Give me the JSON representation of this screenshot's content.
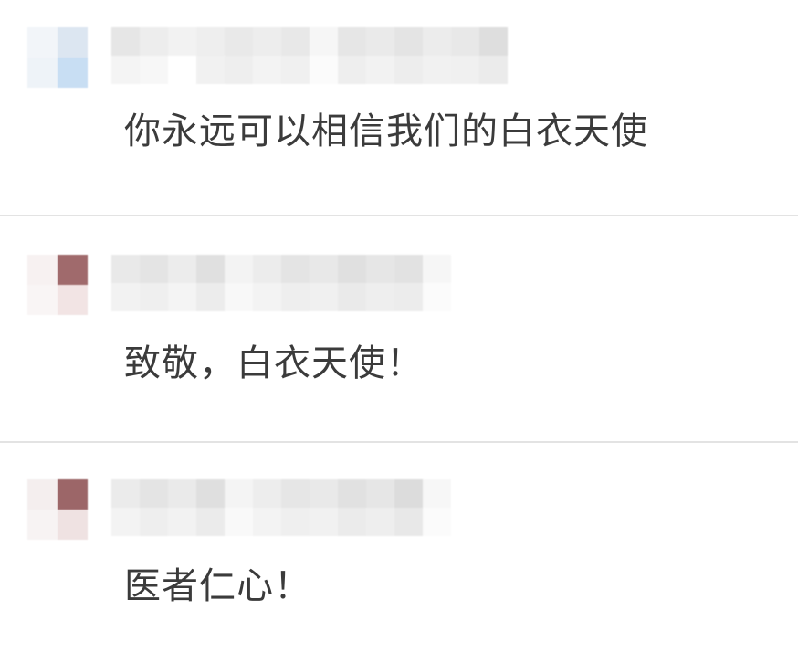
{
  "comments": [
    {
      "text": "你永远可以相信我们的白衣天使",
      "avatar_colors": [
        "#f2f5f9",
        "#dce6f1",
        "#eef3f8",
        "#c8def3"
      ],
      "name_colors": [
        [
          "#e6e6e6",
          "#f4f4f4"
        ],
        [
          "#ededed",
          "#f7f7f7"
        ],
        [
          "#f2f2f2",
          "#ffffff"
        ],
        [
          "#eeeeee",
          "#f1f1f1"
        ],
        [
          "#e9e9e9",
          "#eeeeee"
        ],
        [
          "#ededed",
          "#f3f3f3"
        ],
        [
          "#e8e8e8",
          "#f0f0f0"
        ],
        [
          "#f6f6f6",
          "#fbfbfb"
        ],
        [
          "#e6e6e6",
          "#eeeeee"
        ],
        [
          "#eaeaea",
          "#f2f2f2"
        ],
        [
          "#e4e4e4",
          "#ededed"
        ],
        [
          "#ececec",
          "#f1f1f1"
        ],
        [
          "#e8e8e8",
          "#f0f0f0"
        ],
        [
          "#dedede",
          "#ebebeb"
        ]
      ]
    },
    {
      "text": "致敬，白衣天使！",
      "avatar_colors": [
        "#f7f1f1",
        "#a06a6c",
        "#f9f5f5",
        "#f2e4e4"
      ],
      "name_colors": [
        [
          "#e9e9e9",
          "#f2f2f2"
        ],
        [
          "#e4e4e4",
          "#efefef"
        ],
        [
          "#ececec",
          "#f4f4f4"
        ],
        [
          "#e0e0e0",
          "#ececec"
        ],
        [
          "#f3f3f3",
          "#f8f8f8"
        ],
        [
          "#ececec",
          "#f3f3f3"
        ],
        [
          "#e4e4e4",
          "#eeeeee"
        ],
        [
          "#e8e8e8",
          "#f0f0f0"
        ],
        [
          "#e0e0e0",
          "#eaeaea"
        ],
        [
          "#e6e6e6",
          "#eeeeee"
        ],
        [
          "#e2e2e2",
          "#ececec"
        ],
        [
          "#f6f6f6",
          "#fbfbfb"
        ]
      ]
    },
    {
      "text": "医者仁心！",
      "avatar_colors": [
        "#f4eeee",
        "#9c6668",
        "#f7f3f3",
        "#efe2e2"
      ],
      "name_colors": [
        [
          "#ebebeb",
          "#f3f3f3"
        ],
        [
          "#e4e4e4",
          "#eeeeee"
        ],
        [
          "#eaeaea",
          "#f2f2f2"
        ],
        [
          "#dfdfdf",
          "#ebebeb"
        ],
        [
          "#f4f4f4",
          "#f9f9f9"
        ],
        [
          "#ededed",
          "#f3f3f3"
        ],
        [
          "#e6e6e6",
          "#efefef"
        ],
        [
          "#e9e9e9",
          "#f1f1f1"
        ],
        [
          "#e1e1e1",
          "#ebebeb"
        ],
        [
          "#e6e6e6",
          "#eeeeee"
        ],
        [
          "#dcdcdc",
          "#e8e8e8"
        ],
        [
          "#f7f7f7",
          "#fbfbfb"
        ]
      ]
    }
  ]
}
